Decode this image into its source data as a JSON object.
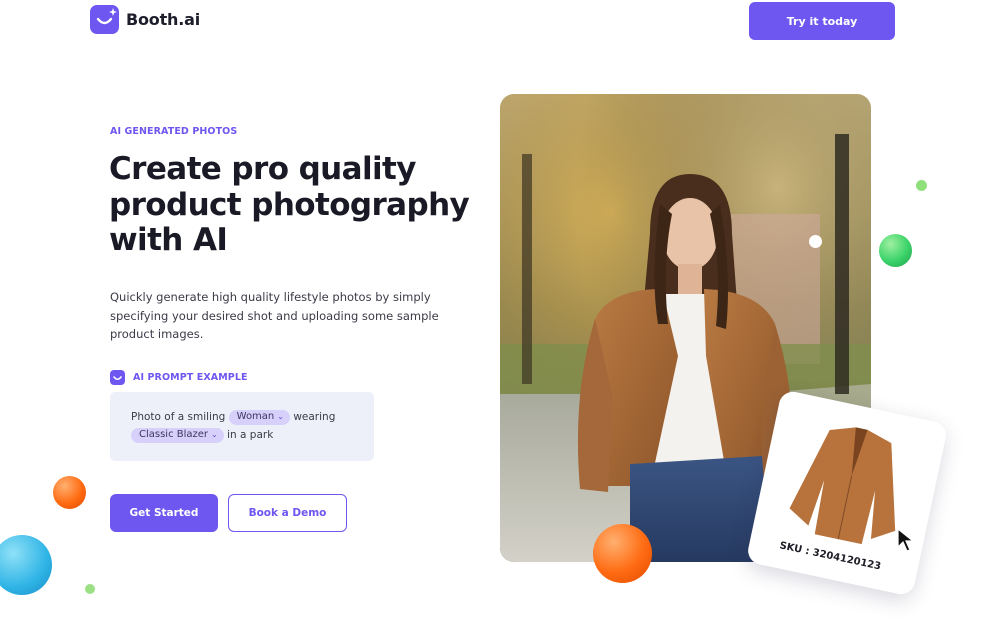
{
  "header": {
    "brand": "Booth.ai",
    "cta_label": "Try it today"
  },
  "hero": {
    "eyebrow": "AI GENERATED PHOTOS",
    "headline_line1": "Create pro quality",
    "headline_line2": "product photography",
    "headline_line3": "with AI",
    "description": "Quickly generate high quality lifestyle photos by simply specifying your desired shot and uploading some sample product images.",
    "prompt_label": "AI PROMPT EXAMPLE",
    "prompt": {
      "text1": "Photo of a smiling",
      "chip1": "Woman",
      "text2": "wearing",
      "chip2": "Classic Blazer",
      "text3": "in a park"
    },
    "primary_button": "Get Started",
    "secondary_button": "Book a Demo"
  },
  "product_card": {
    "sku": "SKU : 3204120123"
  },
  "colors": {
    "accent": "#6e56f0",
    "prompt_bg": "#edf0f9",
    "chip_bg": "#d6d0fb"
  },
  "icons": [
    "logo-smile-icon",
    "sparkle-icon",
    "chevron-down-icon",
    "cursor-arrow-icon"
  ]
}
